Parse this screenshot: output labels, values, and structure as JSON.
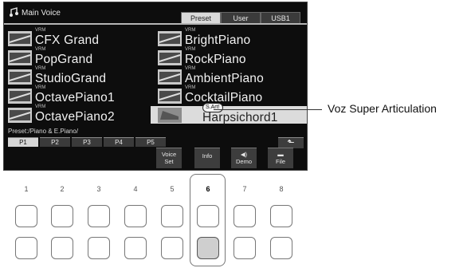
{
  "screen": {
    "title": "Main Voice",
    "tabs": [
      "Preset",
      "User",
      "USB1"
    ],
    "voices": [
      {
        "tag": "VRM",
        "name": "CFX Grand"
      },
      {
        "tag": "VRM",
        "name": "PopGrand"
      },
      {
        "tag": "VRM",
        "name": "StudioGrand"
      },
      {
        "tag": "VRM",
        "name": "OctavePiano1"
      },
      {
        "tag": "VRM",
        "name": "OctavePiano2"
      },
      {
        "tag": "VRM",
        "name": "BrightPiano"
      },
      {
        "tag": "VRM",
        "name": "RockPiano"
      },
      {
        "tag": "VRM",
        "name": "AmbientPiano"
      },
      {
        "tag": "VRM",
        "name": "CocktailPiano"
      },
      {
        "tag": "S.Art!",
        "name": "Harpsichord1"
      }
    ],
    "path": "Preset:/Piano & E.Piano/",
    "pages": [
      "P1",
      "P2",
      "P3",
      "P4",
      "P5"
    ],
    "bottom": {
      "voice_set": [
        "Voice",
        "Set"
      ],
      "info": "Info",
      "demo": "Demo",
      "file": "File"
    }
  },
  "callout": "Voz Super Articulation",
  "panel": {
    "numbers": [
      "1",
      "2",
      "3",
      "4",
      "5",
      "6",
      "7",
      "8"
    ]
  }
}
